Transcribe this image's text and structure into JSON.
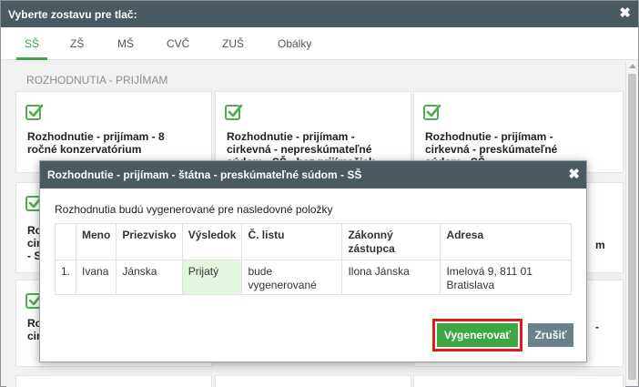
{
  "window": {
    "title": "Vyberte zostavu pre tlač:",
    "close_icon": "close-icon"
  },
  "tabs": [
    {
      "label": "SŠ",
      "active": true
    },
    {
      "label": "ZŠ",
      "active": false
    },
    {
      "label": "MŠ",
      "active": false
    },
    {
      "label": "CVČ",
      "active": false
    },
    {
      "label": "ZUŠ",
      "active": false
    },
    {
      "label": "Obálky",
      "active": false
    }
  ],
  "section": {
    "title": "ROZHODNUTIA - PRIJÍMAM"
  },
  "cards": {
    "c1": "Rozhodnutie - prijímam - 8 ročné konzervatórium",
    "c2": "Rozhodnutie - prijímam - cirkevná - nepreskúmateľné súdom - SŠ - bez prijímačiek",
    "c3": "Rozhodnutie - prijímam - cirkevná - preskúmateľné súdom - SŠ",
    "left_partial_r2": "Ro\ncir\n- S",
    "left_partial_r3": "Ro\ncir",
    "right_partial_r2": "m",
    "right_partial_r3": "-"
  },
  "accent": {
    "green": "#3ea64a",
    "header": "#4a5a62",
    "danger_outline": "#e01b1b"
  },
  "modal": {
    "title": "Rozhodnutie - prijímam - štátna - preskúmateľné súdom - SŠ",
    "description": "Rozhodnutia budú vygenerované pre nasledovné položky",
    "columns": [
      "",
      "Meno",
      "Priezvisko",
      "Výsledok",
      "Č. listu",
      "Zákonný zástupca",
      "Adresa"
    ],
    "rows": [
      {
        "index": "1.",
        "meno": "Ivana",
        "priezvisko": "Jánska",
        "vysledok": "Prijatý",
        "cislo_listu": "bude vygenerované",
        "zastupca": "Ilona Jánska",
        "adresa": "Imelová 9, 811 01 Bratislava"
      }
    ],
    "generate_label": "Vygenerovať",
    "cancel_label": "Zrušiť"
  }
}
